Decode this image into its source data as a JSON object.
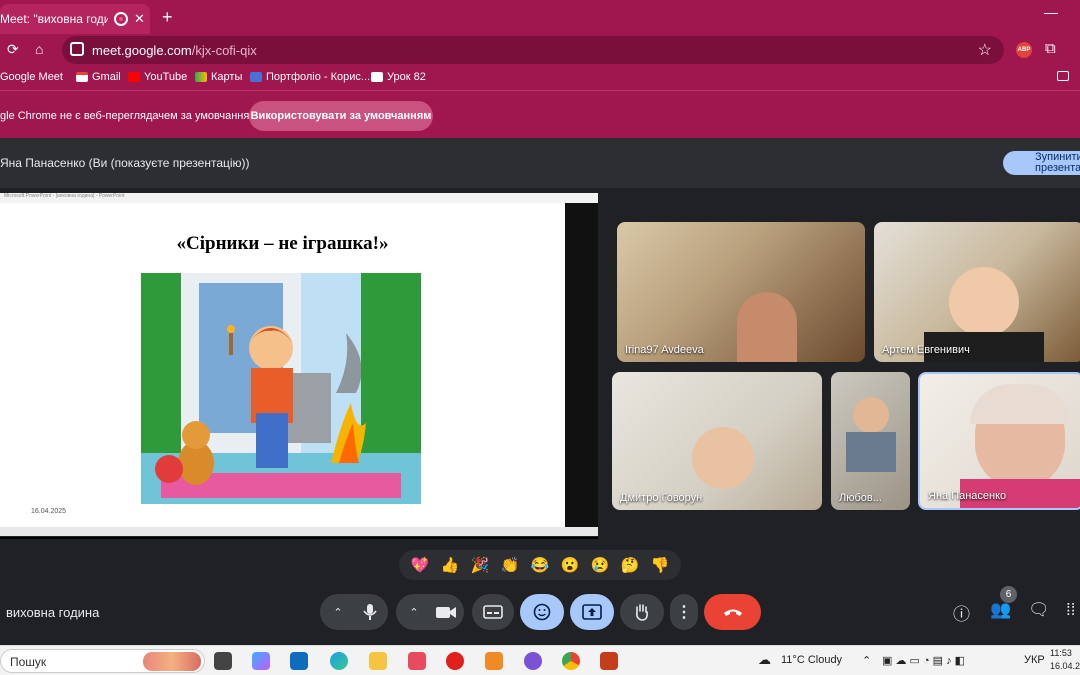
{
  "browser": {
    "tab_title": "Meet: \"виховна година\"",
    "url_host": "meet.google.com",
    "url_path": "/kjx-cofi-qix",
    "bookmarks": [
      {
        "label": "Google Meet",
        "icon": "meet-icon"
      },
      {
        "label": "Gmail",
        "icon": "gmail-icon"
      },
      {
        "label": "YouTube",
        "icon": "youtube-icon"
      },
      {
        "label": "Карты",
        "icon": "maps-icon"
      },
      {
        "label": "Портфоліо - Корис...",
        "icon": "portfolio-icon"
      },
      {
        "label": "Урок 82",
        "icon": "lesson-icon"
      }
    ],
    "infobar_message": "gle Chrome не є веб-переглядачем за умовчанням",
    "infobar_button": "Використовувати за умовчанням"
  },
  "meet": {
    "presenter_text": "Яна Панасенко (Ви (показуєте презентацію))",
    "stop_button": "Зупинити презентац",
    "slide": {
      "titlebar": "Microsoft PowerPoint - [виховна година] - PowerPoint",
      "title": "«Сірники – не іграшка!»",
      "date": "16.04.2025"
    },
    "participants": [
      {
        "name": "Irina97 Avdeeva"
      },
      {
        "name": "Артем Евгенивич"
      },
      {
        "name": "Дмитро Говорун"
      },
      {
        "name": "Любов..."
      },
      {
        "name": "Яна Панасенко"
      }
    ],
    "reactions": [
      "💖",
      "👍",
      "🎉",
      "👏",
      "😂",
      "😮",
      "😢",
      "🤔",
      "👎"
    ],
    "meeting_name": "виховна година",
    "people_count": "6"
  },
  "taskbar": {
    "search_label": "Пошук",
    "weather": "11°C  Cloudy",
    "language": "УКР",
    "time": "11:53",
    "date": "16.04.2025"
  },
  "colors": {
    "chrome_accent": "#a0174f",
    "meet_bg": "#202124",
    "meet_blue": "#a8c7fa",
    "end_call_red": "#ea4335"
  }
}
